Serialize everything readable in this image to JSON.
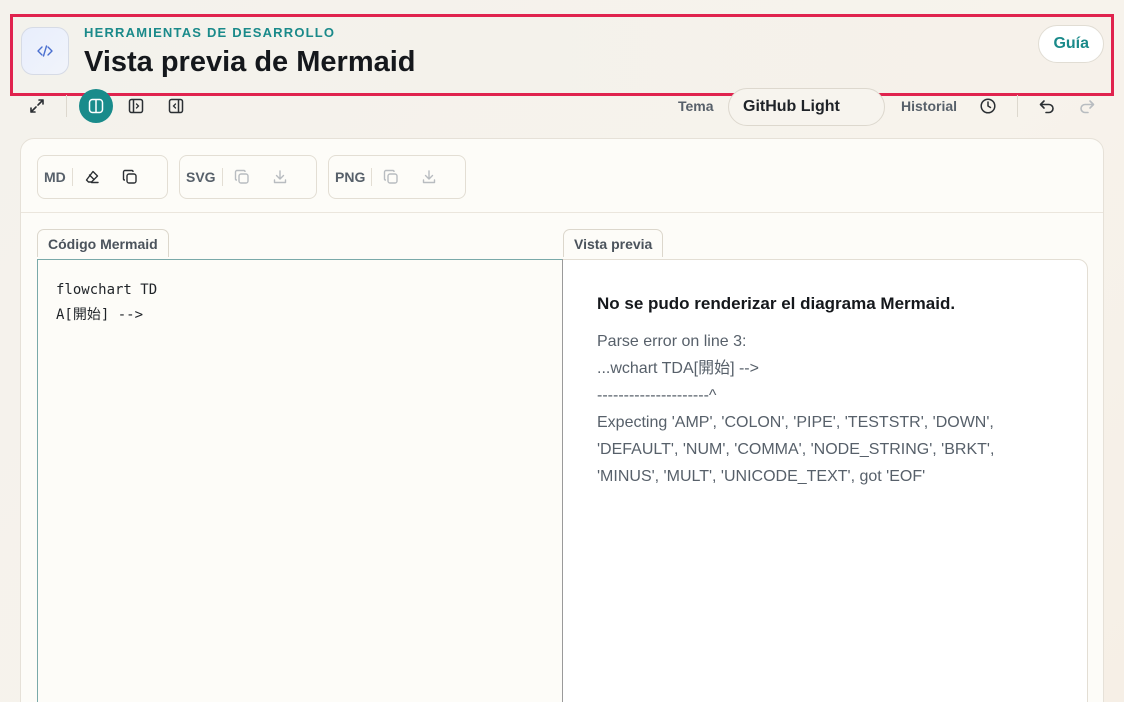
{
  "header": {
    "eyebrow": "HERRAMIENTAS DE DESARROLLO",
    "title": "Vista previa de Mermaid",
    "guide_label": "Guía",
    "app_icon": "code-icon"
  },
  "toolbar": {
    "theme_label": "Tema",
    "theme_value": "GitHub Light",
    "history_label": "Historial",
    "icons": [
      "expand-icon",
      "split-view-icon",
      "editor-only-icon",
      "preview-only-icon",
      "clock-icon",
      "undo-icon",
      "redo-icon"
    ]
  },
  "actions": {
    "md_label": "MD",
    "svg_label": "SVG",
    "png_label": "PNG"
  },
  "tabs": {
    "code_label": "Código Mermaid",
    "preview_label": "Vista previa"
  },
  "editor": {
    "lines": [
      "flowchart TD",
      "A[開始] -->"
    ]
  },
  "preview": {
    "error_title": "No se pudo renderizar el diagrama Mermaid.",
    "error_lines": [
      "Parse error on line 3:",
      "...wchart TDA[開始] -->",
      "---------------------^",
      "Expecting 'AMP', 'COLON', 'PIPE', 'TESTSTR', 'DOWN',",
      "'DEFAULT', 'NUM', 'COMMA', 'NODE_STRING', 'BRKT',",
      "'MINUS', 'MULT', 'UNICODE_TEXT', got 'EOF'"
    ]
  },
  "colors": {
    "accent": "#198b8b",
    "highlight_border": "#e0234e"
  }
}
